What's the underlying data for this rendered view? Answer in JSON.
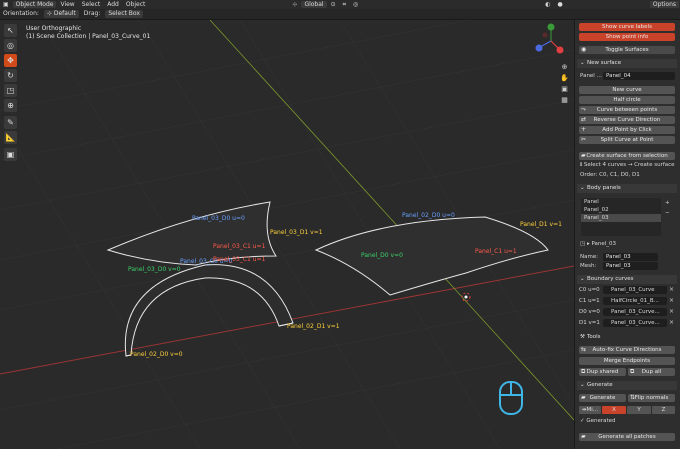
{
  "topbar": {
    "mode": "Object Mode",
    "menus": [
      "View",
      "Select",
      "Add",
      "Object"
    ],
    "transform": "Global",
    "options": "Options"
  },
  "headerbar": {
    "orientation_label": "Orientation:",
    "orientation_value": "Default",
    "drag_label": "Drag:",
    "drag_value": "Select Box"
  },
  "viewport": {
    "view_name": "User Orthographic",
    "collection": "(1) Scene Collection | Panel_03_Curve_01",
    "labels": [
      {
        "text": "Panel_03_D0 u=0",
        "color": "#6aa0ff"
      },
      {
        "text": "Panel_03_D1 v=1",
        "color": "#ffd23c"
      },
      {
        "text": "Panel_03_C1 u=1",
        "color": "#ff5a4a"
      },
      {
        "text": "Panel_03_D0 v=0",
        "color": "#3cd26a"
      },
      {
        "text": "Panel_03_C0 u=0",
        "color": "#6aa0ff"
      },
      {
        "text": "Panel_03_C1 u=1",
        "color": "#ff5a4a"
      },
      {
        "text": "Panel_02_D1 v=1",
        "color": "#ffd23c"
      },
      {
        "text": "Panel_02_D0 v=0",
        "color": "#ffd23c"
      },
      {
        "text": "Panel_02_D0 u=0",
        "color": "#6aa0ff"
      },
      {
        "text": "Panel_D1 v=1",
        "color": "#ffd23c"
      },
      {
        "text": "Panel_D0 v=0",
        "color": "#3cd26a"
      },
      {
        "text": "Panel_C1 u=1",
        "color": "#ff5a4a"
      }
    ]
  },
  "sidebar": {
    "show_curve_labels": "Show curve labels",
    "show_point_info": "Show point info",
    "toggle_surfaces": "Toggle Surfaces",
    "new_surface_section": "New surface",
    "panel_name_label": "Panel ...",
    "panel_name_value": "Panel_04",
    "new_curve": "New curve",
    "half_circle": "Half circle",
    "curve_between_points": "Curve between points",
    "reverse_curve_direction": "Reverse Curve Direction",
    "add_point_by_click": "Add Point by Click",
    "split_curve_at_point": "Split Curve at Point",
    "create_surface_from_selection": "Create surface from selection",
    "select_hint": "Select 4 curves → Create surface",
    "order": "Order: C0, C1, D0, D1",
    "body_panels_section": "Body panels",
    "panels": [
      "Panel",
      "Panel_02",
      "Panel_03"
    ],
    "active_panel": "Panel_03",
    "name_label": "Name:",
    "name_value": "Panel_03",
    "mesh_label": "Mesh:",
    "mesh_value": "Panel_03",
    "boundary_curves_section": "Boundary curves",
    "boundary": [
      {
        "key": "C0 u=0",
        "value": "Panel_03_Curve"
      },
      {
        "key": "C1 u=1",
        "value": "HalfCircle_01_B..."
      },
      {
        "key": "D0 v=0",
        "value": "Panel_03_Curve..."
      },
      {
        "key": "D1 v=1",
        "value": "Panel_03_Curve..."
      }
    ],
    "tools_section": "Tools",
    "auto_fix": "Auto-fix Curve Directions",
    "merge_endpoints": "Merge Endpoints",
    "dup_shared": "Dup shared",
    "dup_all": "Dup all",
    "generate_section": "Generate",
    "generate": "Generate",
    "flip_normals": "Flip normals",
    "mirror": "Mi...",
    "axes": [
      "X",
      "Y",
      "Z"
    ],
    "generated": "Generated",
    "generate_all": "Generate all patches"
  }
}
